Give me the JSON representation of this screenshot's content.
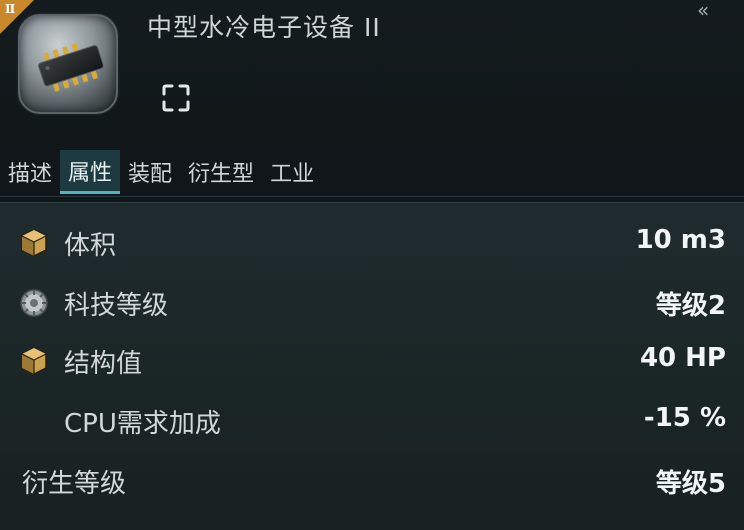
{
  "header": {
    "tech_badge": "II",
    "title": "中型水冷电子设备 II",
    "collapse_icon": "double-chevron-left-icon",
    "expand_icon": "expand-corners-icon",
    "item_icon": "electronics-chip-icon"
  },
  "tabs": [
    {
      "label": "描述",
      "active": false
    },
    {
      "label": "属性",
      "active": true
    },
    {
      "label": "装配",
      "active": false
    },
    {
      "label": "衍生型",
      "active": false
    },
    {
      "label": "工业",
      "active": false
    }
  ],
  "attributes": [
    {
      "icon": "cube-icon",
      "label": "体积",
      "value": "10 m3"
    },
    {
      "icon": "tech-level-gear-icon",
      "label": "科技等级",
      "value": "等级2"
    },
    {
      "icon": "cube-icon",
      "label": "结构值",
      "value": "40 HP"
    },
    {
      "icon": "",
      "label": "CPU需求加成",
      "value": "-15 %"
    },
    {
      "icon": "",
      "label": "衍生等级",
      "value": "等级5"
    }
  ],
  "colors": {
    "accent": "#4fb4be",
    "tech_badge": "#c9882a",
    "background": "#101619",
    "panel": "#1f2b2f"
  }
}
